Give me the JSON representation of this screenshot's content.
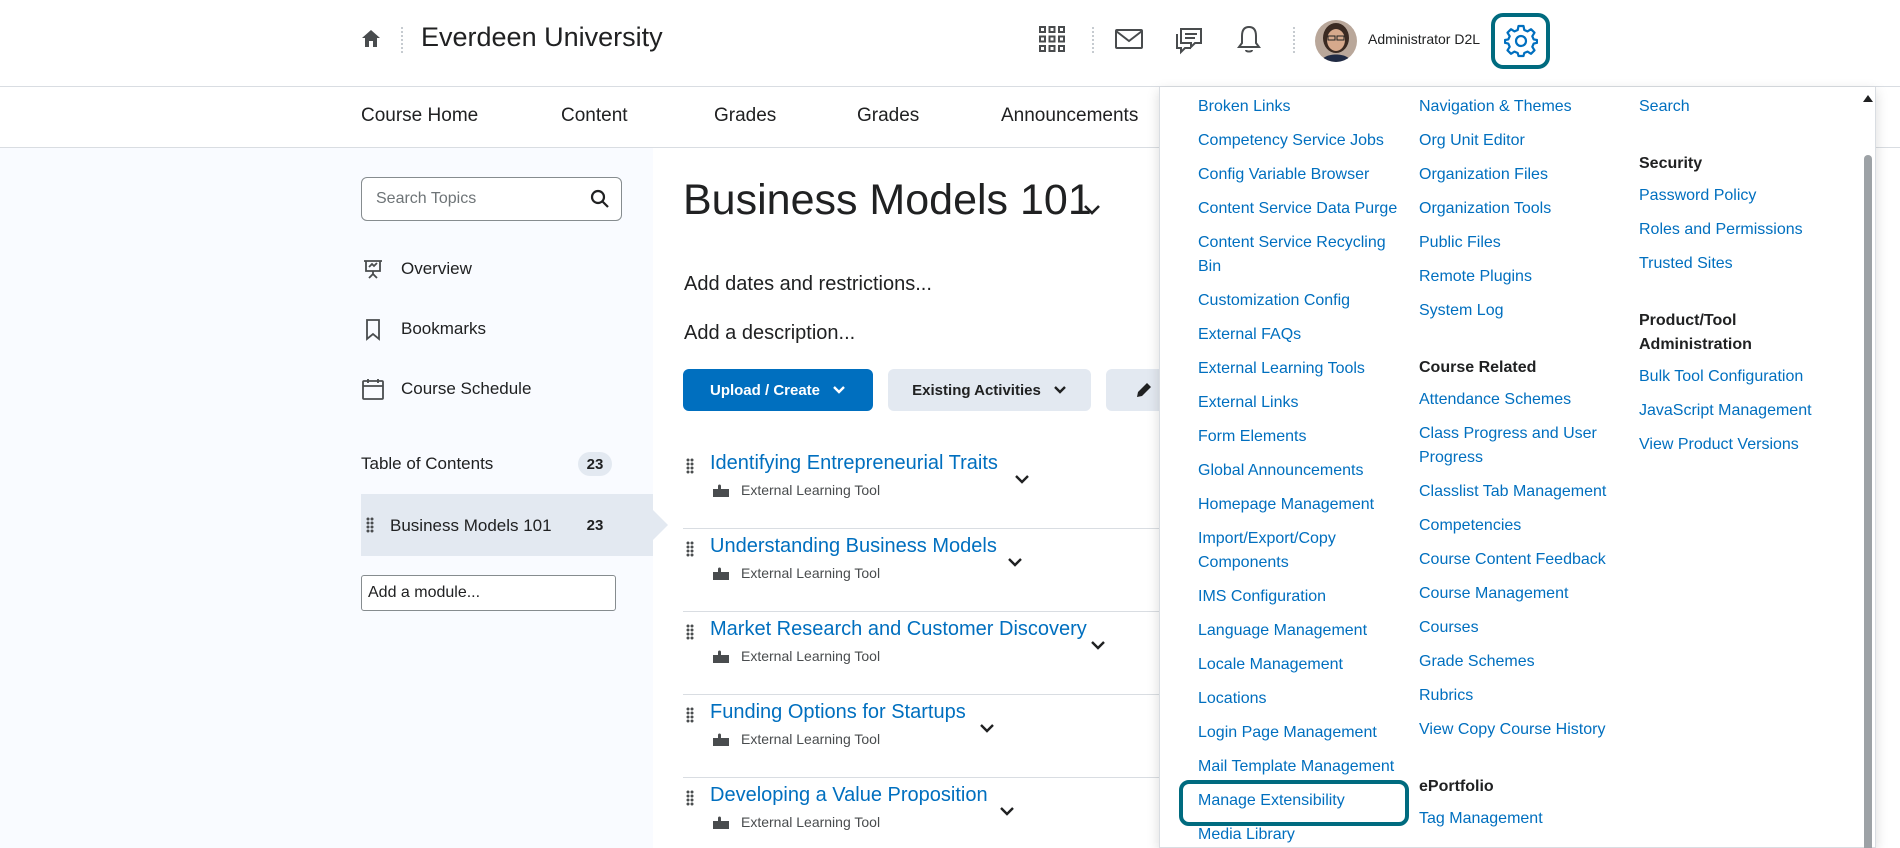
{
  "header": {
    "org_name": "Everdeen University",
    "user_name": "Administrator D2L",
    "icons": [
      "home-icon",
      "waffle-grid-icon",
      "envelope-icon",
      "chat-icon",
      "bell-icon",
      "gear-icon"
    ]
  },
  "nav": {
    "items": [
      "Course Home",
      "Content",
      "Grades",
      "Grades",
      "Announcements"
    ]
  },
  "sidebar": {
    "search_placeholder": "Search Topics",
    "links": [
      "Overview",
      "Bookmarks",
      "Course Schedule"
    ],
    "toc_label": "Table of Contents",
    "toc_count": "23",
    "module_name": "Business Models 101",
    "module_count": "23",
    "add_module_placeholder": "Add a module..."
  },
  "main": {
    "title": "Business Models 101",
    "add_dates": "Add dates and restrictions...",
    "add_description": "Add a description...",
    "upload_button": "Upload / Create",
    "existing_button": "Existing Activities",
    "topics": [
      {
        "title": "Identifying Entrepreneurial Traits",
        "type": "External Learning Tool"
      },
      {
        "title": "Understanding Business Models",
        "type": "External Learning Tool"
      },
      {
        "title": "Market Research and Customer Discovery",
        "type": "External Learning Tool"
      },
      {
        "title": "Funding Options for Startups",
        "type": "External Learning Tool"
      },
      {
        "title": "Developing a Value Proposition",
        "type": "External Learning Tool"
      }
    ]
  },
  "admin_menu": {
    "col1": [
      "Broken Links",
      "Competency Service Jobs",
      "Config Variable Browser",
      "Content Service Data Purge",
      "Content Service Recycling",
      "Bin",
      "Customization Config",
      "External FAQs",
      "External Learning Tools",
      "External Links",
      "Form Elements",
      "Global Announcements",
      "Homepage Management",
      "Import/Export/Copy",
      "Components",
      "IMS Configuration",
      "Language Management",
      "Locale Management",
      "Locations",
      "Login Page Management",
      "Mail Template Management",
      "Manage Extensibility",
      "Media Library"
    ],
    "col2_top": [
      "Navigation & Themes",
      "Org Unit Editor",
      "Organization Files",
      "Organization Tools",
      "Public Files",
      "Remote Plugins",
      "System Log"
    ],
    "course_related_heading": "Course Related",
    "course_related": [
      "Attendance Schemes",
      "Class Progress and User",
      "Progress",
      "Classlist Tab Management",
      "Competencies",
      "Course Content Feedback",
      "Course Management",
      "Courses",
      "Grade Schemes",
      "Rubrics",
      "View Copy Course History"
    ],
    "eportfolio_heading": "ePortfolio",
    "eportfolio": [
      "Tag Management"
    ],
    "col3_top": [
      "Search"
    ],
    "security_heading": "Security",
    "security": [
      "Password Policy",
      "Roles and Permissions",
      "Trusted Sites"
    ],
    "product_heading_1": "Product/Tool",
    "product_heading_2": "Administration",
    "product": [
      "Bulk Tool Configuration",
      "JavaScript Management",
      "View Product Versions"
    ],
    "highlighted_item": "Manage Extensibility"
  },
  "colors": {
    "link": "#006fbf",
    "highlight_border": "#006b7f",
    "selected_bg": "#e3e9f1"
  }
}
